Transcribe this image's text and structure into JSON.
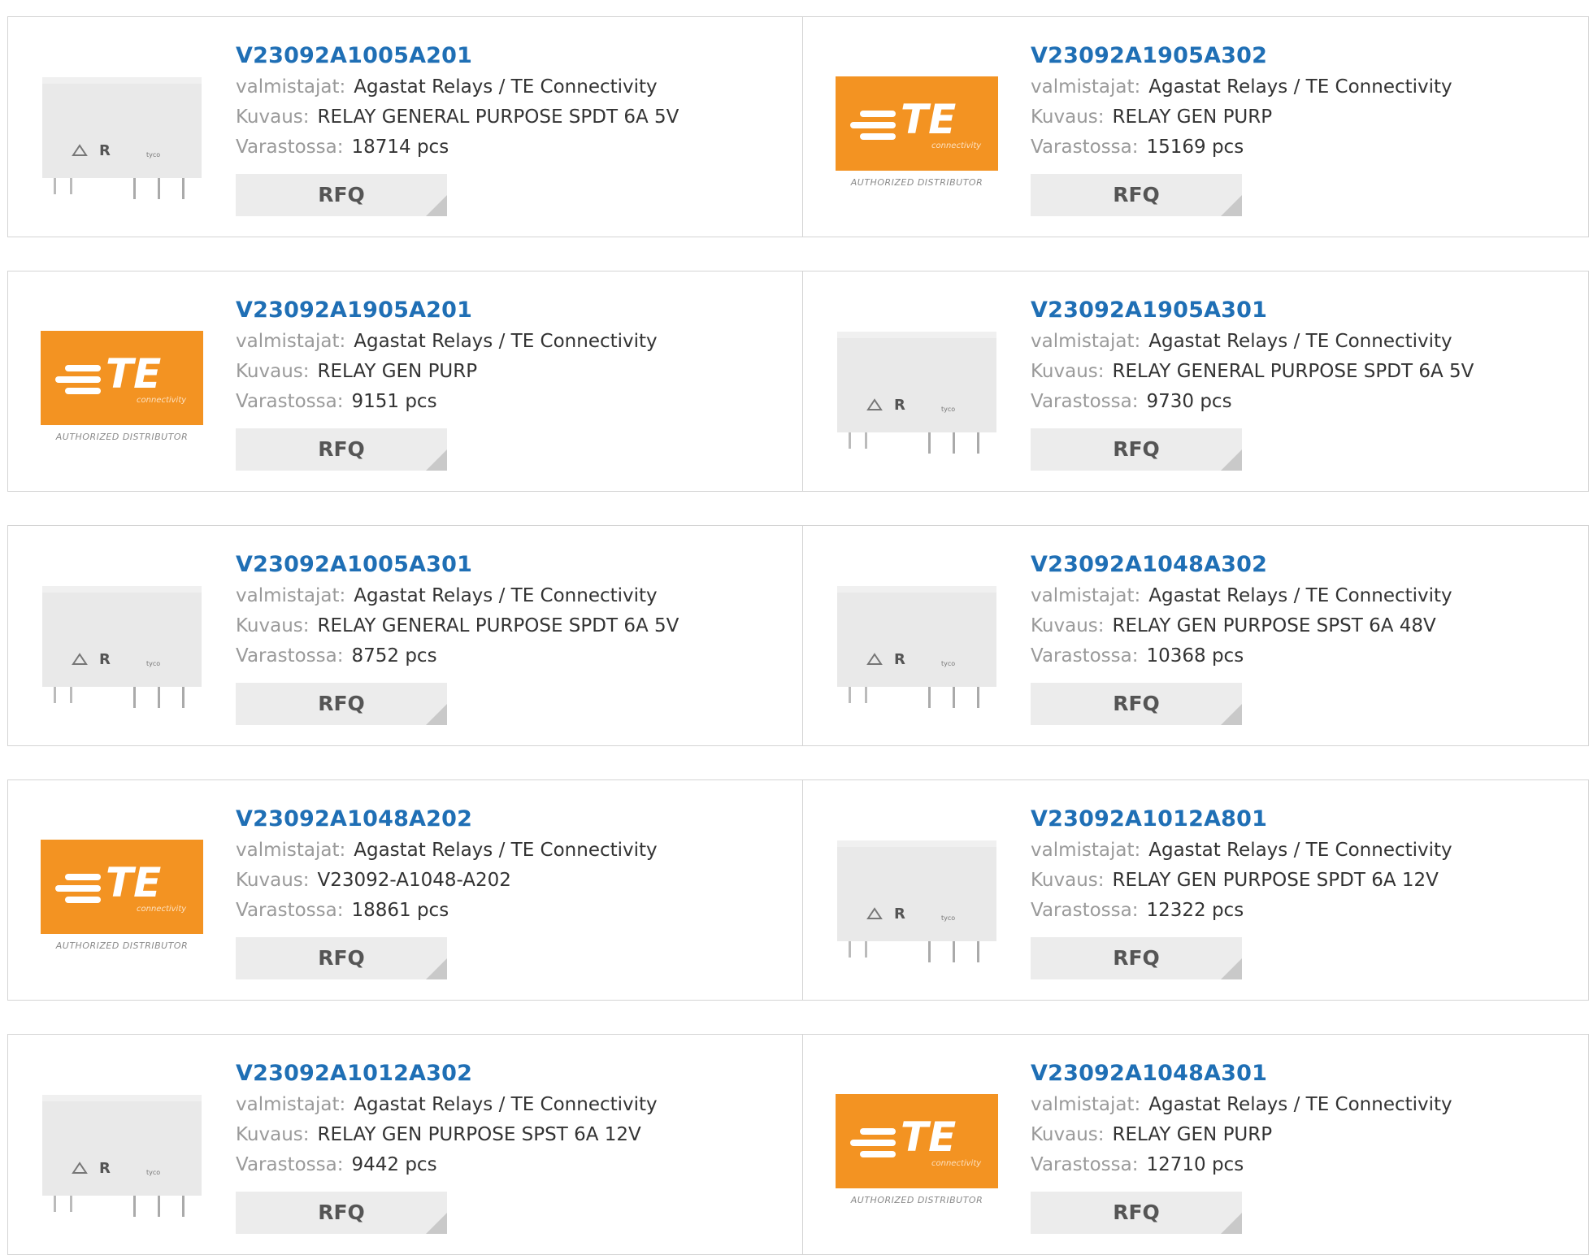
{
  "labels": {
    "manufacturer": "valmistajat:",
    "description": "Kuvaus:",
    "stock": "Varastossa:",
    "rfq": "RFQ"
  },
  "logo": {
    "brand": "TE",
    "sub": "connectivity",
    "distributor": "AUTHORIZED DISTRIBUTOR"
  },
  "colors": {
    "title": "#1f6fb5",
    "brand_orange": "#f39322"
  },
  "rows": [
    {
      "items": [
        {
          "part": "V23092A1005A201",
          "manufacturer": "Agastat Relays / TE Connectivity",
          "description": "RELAY GENERAL PURPOSE SPDT 6A 5V",
          "stock": "18714 pcs",
          "image": "relay"
        },
        {
          "part": "V23092A1905A302",
          "manufacturer": "Agastat Relays / TE Connectivity",
          "description": "RELAY GEN PURP",
          "stock": "15169 pcs",
          "image": "te-logo"
        }
      ]
    },
    {
      "items": [
        {
          "part": "V23092A1905A201",
          "manufacturer": "Agastat Relays / TE Connectivity",
          "description": "RELAY GEN PURP",
          "stock": "9151 pcs",
          "image": "te-logo"
        },
        {
          "part": "V23092A1905A301",
          "manufacturer": "Agastat Relays / TE Connectivity",
          "description": "RELAY GENERAL PURPOSE SPDT 6A 5V",
          "stock": "9730 pcs",
          "image": "relay"
        }
      ]
    },
    {
      "items": [
        {
          "part": "V23092A1005A301",
          "manufacturer": "Agastat Relays / TE Connectivity",
          "description": "RELAY GENERAL PURPOSE SPDT 6A 5V",
          "stock": "8752 pcs",
          "image": "relay"
        },
        {
          "part": "V23092A1048A302",
          "manufacturer": "Agastat Relays / TE Connectivity",
          "description": "RELAY GEN PURPOSE SPST 6A 48V",
          "stock": "10368 pcs",
          "image": "relay"
        }
      ]
    },
    {
      "items": [
        {
          "part": "V23092A1048A202",
          "manufacturer": "Agastat Relays / TE Connectivity",
          "description": "V23092-A1048-A202",
          "stock": "18861 pcs",
          "image": "te-logo"
        },
        {
          "part": "V23092A1012A801",
          "manufacturer": "Agastat Relays / TE Connectivity",
          "description": "RELAY GEN PURPOSE SPDT 6A 12V",
          "stock": "12322 pcs",
          "image": "relay"
        }
      ]
    },
    {
      "items": [
        {
          "part": "V23092A1012A302",
          "manufacturer": "Agastat Relays / TE Connectivity",
          "description": "RELAY GEN PURPOSE SPST 6A 12V",
          "stock": "9442 pcs",
          "image": "relay"
        },
        {
          "part": "V23092A1048A301",
          "manufacturer": "Agastat Relays / TE Connectivity",
          "description": "RELAY GEN PURP",
          "stock": "12710 pcs",
          "image": "te-logo"
        }
      ]
    }
  ]
}
